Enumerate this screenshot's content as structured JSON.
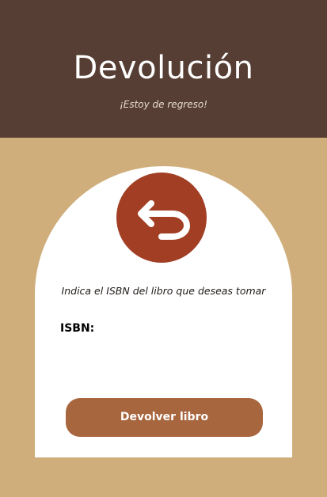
{
  "header": {
    "title": "Devolución",
    "subtitle": "¡Estoy de regreso!"
  },
  "card": {
    "icon": "return-arrow-icon",
    "instruction": "Indica el ISBN del libro que deseas tomar",
    "isbn": {
      "label": "ISBN:",
      "value": "",
      "placeholder": ""
    },
    "submit_label": "Devolver libro"
  },
  "colors": {
    "page_background": "#cfae7c",
    "header_background": "#573e34",
    "icon_background": "#a23e23",
    "button_background": "#a8663f",
    "card_background": "#ffffff"
  }
}
